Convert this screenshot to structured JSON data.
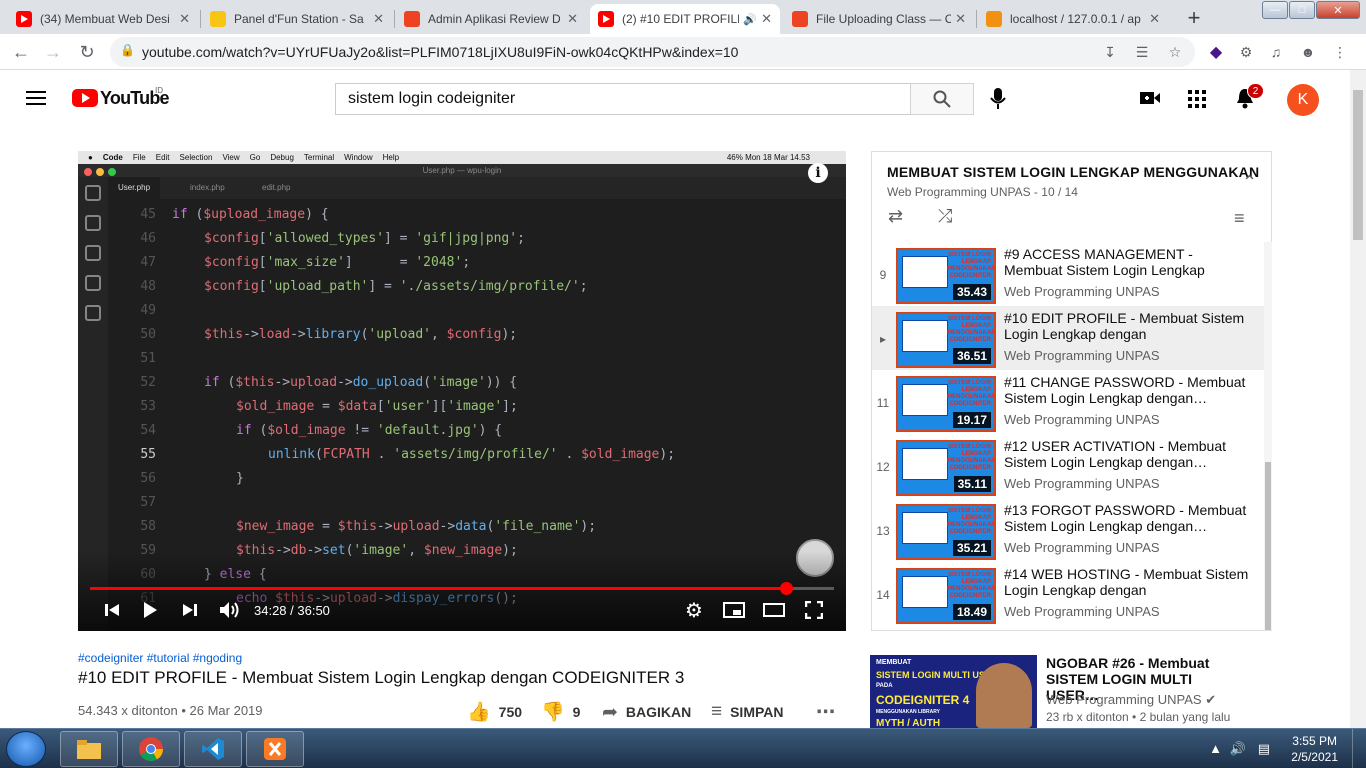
{
  "window": {
    "controls": [
      "—",
      "□",
      "✕"
    ]
  },
  "browser": {
    "tabs": [
      {
        "title": "(34) Membuat Web Desi",
        "favicon": "youtube-icon"
      },
      {
        "title": "Panel d'Fun Station - Sa",
        "favicon": "trophy-icon"
      },
      {
        "title": "Admin Aplikasi Review D",
        "favicon": "codeigniter-icon"
      },
      {
        "title": "(2) #10 EDIT PROFILE",
        "favicon": "youtube-icon",
        "active": true
      },
      {
        "title": "File Uploading Class — C",
        "favicon": "codeigniter-icon"
      },
      {
        "title": "localhost / 127.0.0.1 / ap",
        "favicon": "phpmyadmin-icon"
      }
    ],
    "url": "youtube.com/watch?v=UYrUFUaJy2o&list=PLFIM0718LjIXU8uI9FiN-owk04cQKtHPw&index=10"
  },
  "youtube": {
    "logo": "YouTube",
    "region": "ID",
    "search_value": "sistem login codeigniter",
    "notifications": "2",
    "avatar_letter": "K"
  },
  "video": {
    "mac_menu": [
      "Code",
      "File",
      "Edit",
      "Selection",
      "View",
      "Go",
      "Debug",
      "Terminal",
      "Window",
      "Help"
    ],
    "mac_status": "46%   Mon 18 Mar  14.53",
    "window_title": "User.php — wpu-login",
    "editor_tabs": [
      "User.php",
      "index.php",
      "edit.php"
    ],
    "code_lines": [
      {
        "n": "45",
        "html": "<span class='kw'>if</span> <span class='op'>(</span><span class='vr'>$upload_image</span><span class='op'>) {</span>",
        "indent": 96
      },
      {
        "n": "46",
        "html": "<span class='vr'>$config</span><span class='op'>[</span><span class='st'>'allowed_types'</span><span class='op'>] = </span><span class='st'>'gif|jpg|png'</span><span class='op'>;</span>",
        "indent": 128
      },
      {
        "n": "47",
        "html": "<span class='vr'>$config</span><span class='op'>[</span><span class='st'>'max_size'</span><span class='op'>]      = </span><span class='st'>'2048'</span><span class='op'>;</span>",
        "indent": 128
      },
      {
        "n": "48",
        "html": "<span class='vr'>$config</span><span class='op'>[</span><span class='st'>'upload_path'</span><span class='op'>] = </span><span class='st'>'./assets/img/profile/'</span><span class='op'>;</span>",
        "indent": 128
      },
      {
        "n": "49",
        "html": "",
        "indent": 128
      },
      {
        "n": "50",
        "html": "<span class='vr'>$this</span><span class='op'>-></span><span class='vr'>load</span><span class='op'>-></span><span class='fn'>library</span><span class='op'>(</span><span class='st'>'upload'</span><span class='op'>, </span><span class='vr'>$config</span><span class='op'>);</span>",
        "indent": 128
      },
      {
        "n": "51",
        "html": "",
        "indent": 128
      },
      {
        "n": "52",
        "html": "<span class='kw'>if</span> <span class='op'>(</span><span class='vr'>$this</span><span class='op'>-></span><span class='vr'>upload</span><span class='op'>-></span><span class='fn'>do_upload</span><span class='op'>(</span><span class='st'>'image'</span><span class='op'>)) {</span>",
        "indent": 128
      },
      {
        "n": "53",
        "html": "<span class='vr'>$old_image</span><span class='op'> = </span><span class='vr'>$data</span><span class='op'>[</span><span class='st'>'user'</span><span class='op'>][</span><span class='st'>'image'</span><span class='op'>];</span>",
        "indent": 160
      },
      {
        "n": "54",
        "html": "<span class='kw'>if</span> <span class='op'>(</span><span class='vr'>$old_image</span><span class='op'> != </span><span class='st'>'default.jpg'</span><span class='op'>) {</span>",
        "indent": 160
      },
      {
        "n": "55",
        "html": "<span class='fn'>unlink</span><span class='op'>(</span><span class='vr'>FCPATH</span><span class='op'> . </span><span class='st'>'assets/img/profile/'</span><span class='op'> . </span><span class='vr'>$old_image</span><span class='op'>);</span>",
        "indent": 192
      },
      {
        "n": "56",
        "html": "<span class='op'>}</span>",
        "indent": 160
      },
      {
        "n": "57",
        "html": "",
        "indent": 160
      },
      {
        "n": "58",
        "html": "<span class='vr'>$new_image</span><span class='op'> = </span><span class='vr'>$this</span><span class='op'>-></span><span class='vr'>upload</span><span class='op'>-></span><span class='fn'>data</span><span class='op'>(</span><span class='st'>'file_name'</span><span class='op'>);</span>",
        "indent": 160
      },
      {
        "n": "59",
        "html": "<span class='vr'>$this</span><span class='op'>-></span><span class='vr'>db</span><span class='op'>-></span><span class='fn'>set</span><span class='op'>(</span><span class='st'>'image'</span><span class='op'>, </span><span class='vr'>$new_image</span><span class='op'>);</span>",
        "indent": 160
      },
      {
        "n": "60",
        "html": "<span class='op'>} </span><span class='kw'>else</span><span class='op'> {</span>",
        "indent": 128
      },
      {
        "n": "61",
        "html": "<span class='kw'>echo</span> <span class='vr'>$this</span><span class='op'>-></span><span class='vr'>upload</span><span class='op'>-></span><span class='fn'>dispay_errors</span><span class='op'>();</span>",
        "indent": 160
      }
    ],
    "time": "34:28 / 36:50",
    "progress": 0.936
  },
  "meta": {
    "hashtags": "#codeigniter #tutorial #ngoding",
    "title": "#10 EDIT PROFILE - Membuat Sistem Login Lengkap dengan CODEIGNITER 3",
    "views_date": "54.343 x ditonton • 26 Mar 2019",
    "likes": "750",
    "dislikes": "9",
    "share": "BAGIKAN",
    "save": "SIMPAN"
  },
  "playlist": {
    "title": "MEMBUAT SISTEM LOGIN LENGKAP MENGGUNAKAN",
    "subtitle": "Web Programming UNPAS - 10 / 14",
    "items": [
      {
        "index": "9",
        "title": "#9 ACCESS MANAGEMENT - Membuat Sistem Login Lengkap dengan…",
        "channel": "Web Programming UNPAS",
        "duration": "35.43"
      },
      {
        "index": "▸",
        "title": "#10 EDIT PROFILE - Membuat Sistem Login Lengkap dengan CODEIGNITER…",
        "channel": "Web Programming UNPAS",
        "duration": "36.51",
        "current": true
      },
      {
        "index": "11",
        "title": "#11 CHANGE PASSWORD - Membuat Sistem Login Lengkap dengan…",
        "channel": "Web Programming UNPAS",
        "duration": "19.17"
      },
      {
        "index": "12",
        "title": "#12 USER ACTIVATION - Membuat Sistem Login Lengkap dengan…",
        "channel": "Web Programming UNPAS",
        "duration": "35.11"
      },
      {
        "index": "13",
        "title": "#13 FORGOT PASSWORD - Membuat Sistem Login Lengkap dengan…",
        "channel": "Web Programming UNPAS",
        "duration": "35.21"
      },
      {
        "index": "14",
        "title": "#14 WEB HOSTING - Membuat Sistem Login Lengkap dengan CODEIGNITER…",
        "channel": "Web Programming UNPAS",
        "duration": "18.49"
      }
    ],
    "thumb_label": "SISTEM LOGIN LENGKAP MENGGUNAKAN CODEIGNITER"
  },
  "recommended": {
    "title": "NGOBAR #26 - Membuat SISTEM LOGIN MULTI USER…",
    "channel": "Web Programming UNPAS",
    "meta": "23 rb x ditonton • 2 bulan yang lalu",
    "thumb_lines": [
      "MEMBUAT",
      "SISTEM LOGIN MULTI USER",
      "PADA",
      "CODEIGNITER 4",
      "MENGGUNAKAN LIBRARY",
      "MYTH / AUTH"
    ]
  },
  "taskbar": {
    "time": "3:55 PM",
    "date": "2/5/2021"
  }
}
